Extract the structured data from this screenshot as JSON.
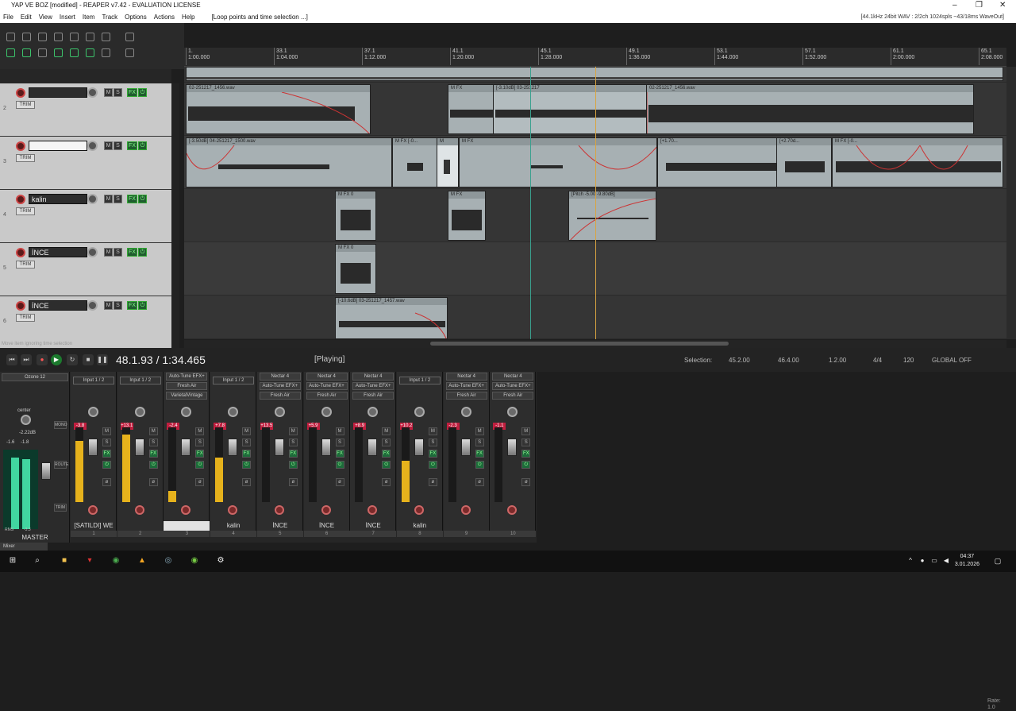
{
  "window": {
    "title": "YAP VE BOZ [modified] - REAPER v7.42 - EVALUATION LICENSE",
    "audio_info": "[44.1kHz 24bit WAV : 2/2ch 1024spls ~43/18ms WaveOut]"
  },
  "menu": {
    "items": [
      "File",
      "Edit",
      "View",
      "Insert",
      "Item",
      "Track",
      "Options",
      "Actions",
      "Help"
    ],
    "status": "[Loop points and time selection ...]"
  },
  "ruler": {
    "labels": [
      {
        "bar": "1.",
        "time": "1:00.000"
      },
      {
        "bar": "33.1",
        "time": "1:04.000"
      },
      {
        "bar": "37.1",
        "time": "1:12.000"
      },
      {
        "bar": "41.1",
        "time": "1:20.000"
      },
      {
        "bar": "45.1",
        "time": "1:28.000"
      },
      {
        "bar": "49.1",
        "time": "1:36.000"
      },
      {
        "bar": "53.1",
        "time": "1:44.000"
      },
      {
        "bar": "57.1",
        "time": "1:52.000"
      },
      {
        "bar": "61.1",
        "time": "2:00.000"
      },
      {
        "bar": "65.1",
        "time": "2:08.000"
      }
    ]
  },
  "tracks": [
    {
      "num": "2",
      "name": "",
      "trim": "TRIM"
    },
    {
      "num": "3",
      "name": "",
      "trim": "TRIM"
    },
    {
      "num": "4",
      "name": "kalin",
      "trim": "TRIM"
    },
    {
      "num": "5",
      "name": "İNCE",
      "trim": "TRIM"
    },
    {
      "num": "6",
      "name": "İNCE",
      "trim": "TRIM"
    }
  ],
  "items": {
    "a": "02-251217_1456.wav",
    "b": "[-3.10dB] 03-251217",
    "c": "[-3.50dB] 04-251217_1500.wav",
    "d": "[Pitch -5.00 -9.80dB]",
    "e": "[-10.6dB] 03-251217_1457.wav",
    "f": "[+1.70...",
    "g": "[+2.70d..."
  },
  "status_msg": "Move item ignoring time selection",
  "transport": {
    "position": "48.1.93 / 1:34.465",
    "state": "[Playing]",
    "selection_label": "Selection:",
    "sel_start": "45.2.00",
    "sel_end": "46.4.00",
    "sel_len": "1.2.00",
    "timesig": "4/4",
    "bpm": "120",
    "rate_label": "Rate:",
    "rate": "1.0",
    "global": "GLOBAL OFF"
  },
  "master": {
    "center": "center",
    "db": "-2.22dB",
    "l": "-1.6",
    "r": "-1.8",
    "rms": "RMS",
    "rms_val": "-3.3",
    "label": "MASTER",
    "top": "Ozone 12",
    "mono": "MONO",
    "route": "ROUTE",
    "trim": "TRIM"
  },
  "strips": [
    {
      "fx": [
        "Input 1 / 2"
      ],
      "peak": "-3.8",
      "label": "[SATILDI] WE",
      "idx": "1",
      "level": 0.82
    },
    {
      "fx": [
        "Input 1 / 2"
      ],
      "peak": "+13.1",
      "label": "",
      "idx": "2",
      "level": 0.9
    },
    {
      "fx": [
        "Auto-Tune EFX+",
        "Fresh Air",
        "VarietalVintage"
      ],
      "peak": "-2.4",
      "label": "",
      "idx": "3",
      "level": 0.15,
      "hl": true
    },
    {
      "fx": [
        "Input 1 / 2"
      ],
      "peak": "+7.8",
      "label": "kalin",
      "idx": "4",
      "level": 0.6
    },
    {
      "fx": [
        "Nectar 4",
        "Auto-Tune EFX+",
        "Fresh Air"
      ],
      "peak": "+13.5",
      "label": "İNCE",
      "idx": "5",
      "level": 0
    },
    {
      "fx": [
        "Nectar 4",
        "Auto-Tune EFX+",
        "Fresh Air"
      ],
      "peak": "+5.9",
      "label": "İNCE",
      "idx": "6",
      "level": 0
    },
    {
      "fx": [
        "Nectar 4",
        "Auto-Tune EFX+",
        "Fresh Air"
      ],
      "peak": "+8.9",
      "label": "İNCE",
      "idx": "7",
      "level": 0
    },
    {
      "fx": [
        "Input 1 / 2"
      ],
      "peak": "+10.2",
      "label": "kalin",
      "idx": "8",
      "level": 0.55
    },
    {
      "fx": [
        "Nectar 4",
        "Auto-Tune EFX+",
        "Fresh Air"
      ],
      "peak": "-2.3",
      "label": "",
      "idx": "9",
      "level": 0
    },
    {
      "fx": [
        "Nectar 4",
        "Auto-Tune EFX+",
        "Fresh Air"
      ],
      "peak": "-1.1",
      "label": "",
      "idx": "10",
      "level": 0
    }
  ],
  "mixer_tab": "Mixer",
  "clock": {
    "time": "04:37",
    "date": "3.01.2026"
  },
  "colors": {
    "accent_green": "#1c7a2e",
    "item": "#a7b0b3",
    "meter_yellow": "#e6b21c",
    "peak_red": "#c01f3f"
  }
}
